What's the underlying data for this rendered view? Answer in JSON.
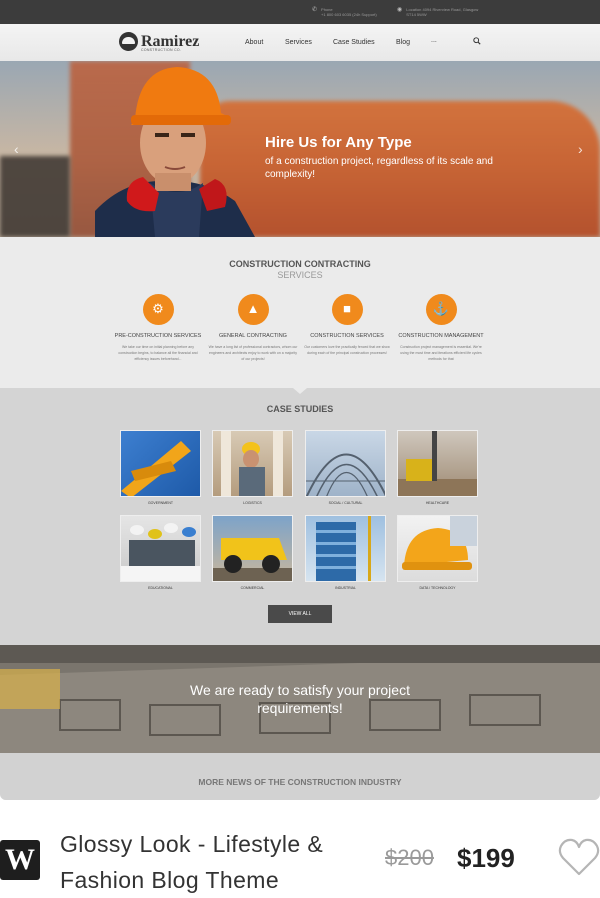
{
  "topbar": {
    "phone_label": "Phone",
    "phone_value": "+1 800 603 6035 (24h Support)",
    "location_label": "Location 4094 Riverview Road, Glasgow",
    "location_value": "ST14 5WW"
  },
  "header": {
    "logo_name": "Ramirez",
    "logo_sub": "CONSTRUCTION CO.",
    "nav": [
      "About",
      "Services",
      "Case Studies",
      "Blog",
      "..."
    ]
  },
  "hero": {
    "title": "Hire Us for Any Type",
    "subtitle": "of a construction project, regardless of its scale and complexity!"
  },
  "services": {
    "title": "CONSTRUCTION CONTRACTING",
    "subtitle": "SERVICES",
    "items": [
      {
        "title": "PRE-CONSTRUCTION SERVICES",
        "icon": "excavator-icon",
        "text": "We take our time on initial planning before any construction begins, to balance all the financial and efficiency issues beforehand..."
      },
      {
        "title": "GENERAL CONTRACTING",
        "icon": "hardhat-icon",
        "text": "We have a long list of professional contractors, whom our engineers and architects enjoy to work with on a majority of our projects!"
      },
      {
        "title": "CONSTRUCTION SERVICES",
        "icon": "truck-icon",
        "text": "Our customers love the practically fenced that we show during each of the principal construction processes!"
      },
      {
        "title": "CONSTRUCTION MANAGEMENT",
        "icon": "crane-hook-icon",
        "text": "Construction project management is essential. We're using the most time and iterations efficient life cycles methods for that"
      }
    ]
  },
  "cases": {
    "title": "CASE STUDIES",
    "items": [
      {
        "label": "GOVERNMENT"
      },
      {
        "label": "LOGISTICS"
      },
      {
        "label": "SOCIAL / CULTURAL"
      },
      {
        "label": "HEALTHCARE"
      },
      {
        "label": "EDUCATIONAL"
      },
      {
        "label": "COMMERCIAL"
      },
      {
        "label": "INDUSTRIAL"
      },
      {
        "label": "DATA / TECHNOLOGY"
      }
    ],
    "view_all": "VIEW ALL"
  },
  "cta": {
    "line1": "We are ready to satisfy your project",
    "line2": "requirements!"
  },
  "news": {
    "title": "MORE NEWS OF THE CONSTRUCTION INDUSTRY"
  },
  "product": {
    "badge": "W",
    "name": "Glossy Look - Lifestyle & Fashion Blog Theme",
    "old_price": "$200",
    "new_price": "$199"
  },
  "colors": {
    "accent": "#f08a1c",
    "topbar": "#3c3c3c",
    "button": "#4a4a4a"
  }
}
